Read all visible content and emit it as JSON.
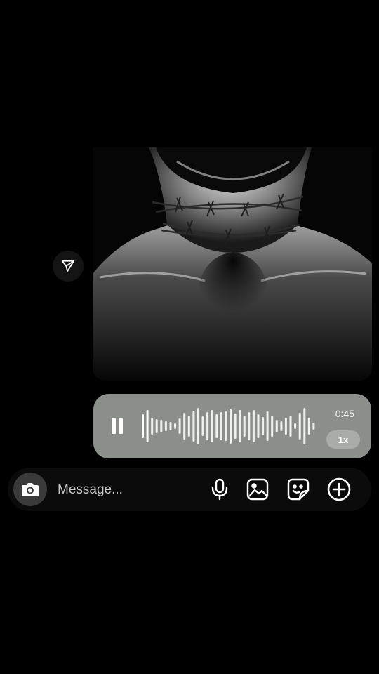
{
  "icons": {
    "share": "paper-plane-icon",
    "pause": "pause-icon",
    "camera": "camera-icon",
    "mic": "microphone-icon",
    "gallery": "image-icon",
    "sticker": "sticker-icon",
    "add": "plus-circle-icon"
  },
  "voice_message": {
    "duration": "0:45",
    "speed": "1x",
    "state": "playing"
  },
  "composer": {
    "placeholder": "Message..."
  },
  "colors": {
    "background": "#000000",
    "voice_bubble": "#8b8f89",
    "composer": "#0b0b0b",
    "camera_button": "#3a3a3a"
  }
}
